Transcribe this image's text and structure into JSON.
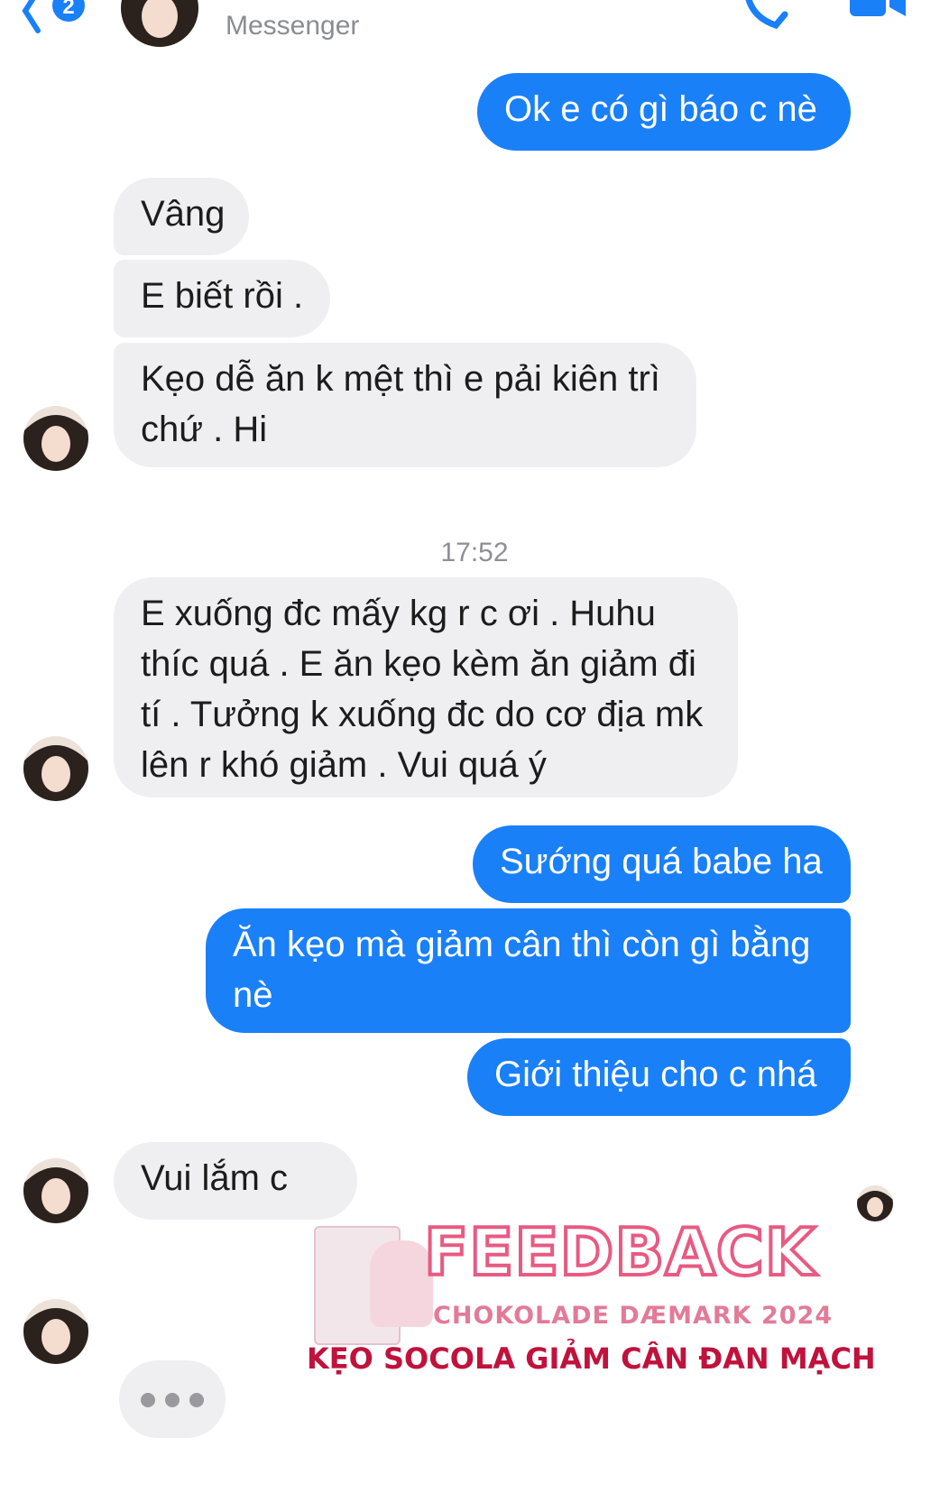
{
  "header": {
    "subtitle": "Messenger",
    "unread_count": "2"
  },
  "messages": [
    {
      "id": "m1",
      "side": "out",
      "text": "Ok e có gì báo c nè"
    },
    {
      "id": "m2",
      "side": "in",
      "text": "Vâng"
    },
    {
      "id": "m3",
      "side": "in",
      "text": "E biết rồi ."
    },
    {
      "id": "m4",
      "side": "in",
      "lines": [
        "Kẹo dễ ăn k mệt thì e pải kiên trì",
        "chứ . Hi"
      ]
    },
    {
      "id": "m5",
      "side": "in",
      "lines": [
        "E xuống đc mấy kg r c ơi . Huhu",
        "thíc quá . E ăn kẹo kèm ăn giảm đi",
        "tí . Tưởng k xuống đc do cơ địa mk",
        "lên r khó giảm . Vui quá ý"
      ]
    },
    {
      "id": "m6",
      "side": "out",
      "text": "Sướng quá babe ha"
    },
    {
      "id": "m7",
      "side": "out",
      "lines": [
        "Ăn kẹo mà giảm cân thì còn gì bằng",
        "nè"
      ]
    },
    {
      "id": "m8",
      "side": "out",
      "text": "Giới thiệu cho c nhá"
    },
    {
      "id": "m9",
      "side": "in",
      "text": "Vui lắm c"
    }
  ],
  "timestamp": "17:52",
  "promo": {
    "title": "FEEDBACK",
    "subtitle": "CHOKOLADE DÆMARK 2024",
    "product": "KẸO SOCOLA GIẢM CÂN ĐAN MẠCH"
  },
  "colors": {
    "outgoing_bubble": "#1a80f8",
    "incoming_bubble": "#efeff1",
    "promo_accent": "#e85a82",
    "promo_product": "#c0123c"
  },
  "icons": {
    "back": "chevron-left-icon",
    "call": "phone-icon",
    "video": "video-camera-icon",
    "typing": "typing-indicator-icon"
  }
}
